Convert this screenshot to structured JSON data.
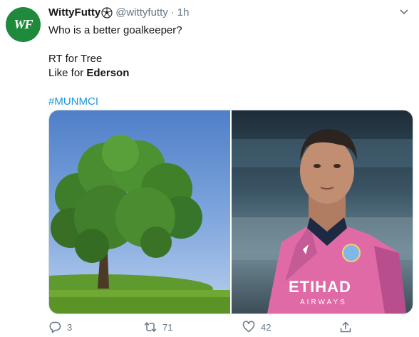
{
  "account": {
    "avatar_text": "WF",
    "avatar_color": "#1f8a3c",
    "name": "WittyFutty",
    "name_emoji": "soccer-ball-icon",
    "handle": "@wittyfutty",
    "separator": "·",
    "time": "1h"
  },
  "tweet": {
    "line1": "Who is a better goalkeeper?",
    "line2": "RT for Tree",
    "line3_prefix": "Like for ",
    "line3_bold": "Ederson",
    "hashtag": "#MUNMCI"
  },
  "media": {
    "left_image": "tree-photo",
    "right_image": "goalkeeper-photo",
    "jersey_sponsor": "ETIHAD",
    "jersey_sponsor_sub": "AIRWAYS"
  },
  "actions": {
    "reply_count": "3",
    "retweet_count": "71",
    "like_count": "42"
  },
  "colors": {
    "link": "#1b95e0",
    "muted": "#657786"
  }
}
